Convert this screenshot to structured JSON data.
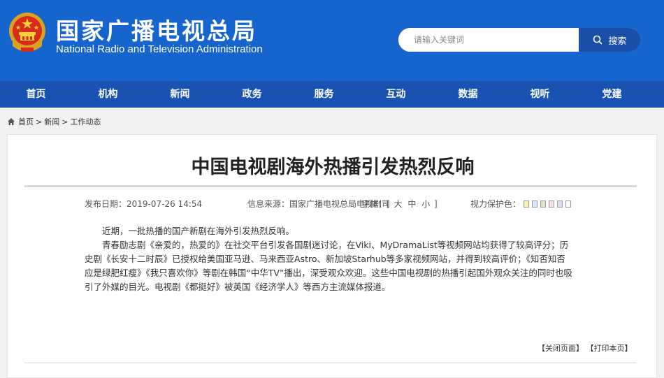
{
  "header": {
    "title_cn": "国家广播电视总局",
    "title_en": "National Radio and Television Administration",
    "emblem_icon": "national-emblem-icon",
    "search": {
      "placeholder": "请输入关键词",
      "button_label": "搜索",
      "icon": "search-icon"
    },
    "colors": {
      "header_bg": "#1665cf",
      "nav_bg": "#1a52b2",
      "search_btn": "#1a4fa8"
    }
  },
  "nav": {
    "items": [
      {
        "label": "首页"
      },
      {
        "label": "机构"
      },
      {
        "label": "新闻"
      },
      {
        "label": "政务"
      },
      {
        "label": "服务"
      },
      {
        "label": "互动"
      },
      {
        "label": "数据"
      },
      {
        "label": "视听"
      },
      {
        "label": "党建"
      }
    ]
  },
  "breadcrumb": {
    "icon": "home-icon",
    "items": [
      {
        "label": "首页"
      },
      {
        "label": "新闻"
      },
      {
        "label": "工作动态"
      }
    ],
    "separator": ">"
  },
  "article": {
    "title": "中国电视剧海外热播引发热烈反响",
    "meta": {
      "date": "发布日期：2019-07-26 14:54",
      "source": "信息来源：国家广播电视总局电视剧司",
      "font_label": "字体：[",
      "font_sizes": [
        "大",
        "中",
        "小"
      ],
      "font_suffix": "]",
      "vision_label": "视力保护色：",
      "vision_colors": [
        "#fbf0a8",
        "#d7e8f7",
        "#dde6cc",
        "#f4dbe6",
        "#e1d8f2",
        "#ffffff"
      ]
    },
    "paragraphs": [
      "近期，一批热播的国产新剧在海外引发热烈反响。",
      "青春励志剧《亲爱的，热爱的》在社交平台引发各国剧迷讨论，在Viki、MyDramaList等视频网站均获得了较高评分；历史剧《长安十二时辰》已授权给美国亚马逊、马来西亚Astro、新加坡Starhub等多家视频网站，并得到较高评价；《知否知否应是绿肥红瘦》《我只喜欢你》等剧在韩国“中华TV”播出，深受观众欢迎。这些中国电视剧的热播引起国外观众关注的同时也吸引了外媒的目光。电视剧《都挺好》被英国《经济学人》等西方主流媒体报道。"
    ],
    "footer": {
      "close_label": "【关闭页面】",
      "print_label": "【打印本页】"
    }
  }
}
